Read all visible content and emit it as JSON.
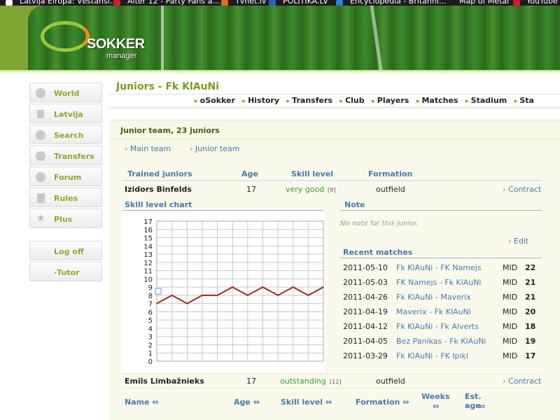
{
  "bookmarks": [
    {
      "label": "Latvija Eiropa: Vēstanši...",
      "icon_color": "#ffffff"
    },
    {
      "label": "Alter 12 - Party Fans a...",
      "icon_color": "#d02020"
    },
    {
      "label": "Tvnet.lv",
      "icon_color": "#e07020"
    },
    {
      "label": "POLITIKA.LV",
      "icon_color": "#3060c0"
    },
    {
      "label": "Encyclopedia - Britanni...",
      "icon_color": "#3080e0"
    },
    {
      "label": "Map of Metal",
      "icon_color": "#202020"
    },
    {
      "label": "YouTube",
      "icon_color": "#cc2020"
    }
  ],
  "logo": {
    "name": "SOKKER",
    "sub": "manager"
  },
  "sidebar": {
    "items": [
      {
        "label": "World",
        "icon": "globe-icon"
      },
      {
        "label": "Latvija",
        "icon": "flag-icon"
      },
      {
        "label": "Search",
        "icon": "magnifier-icon"
      },
      {
        "label": "Transfers",
        "icon": "transfer-arrows-icon"
      },
      {
        "label": "Forum",
        "icon": "people-icon"
      },
      {
        "label": "Rules",
        "icon": "document-icon"
      },
      {
        "label": "Plus",
        "icon": "star-icon"
      }
    ],
    "logoff": "Log off",
    "tutor": "·Tutor"
  },
  "page": {
    "title": "Juniors - Fk KlAuNi"
  },
  "mainnav": [
    "oSokker",
    "History",
    "Transfers",
    "Club",
    "Players",
    "Matches",
    "Stadium",
    "Sta"
  ],
  "panel": {
    "heading": "Junior team, 23 juniors",
    "tabs": [
      "Main team",
      "Junior team"
    ]
  },
  "trained_table": {
    "headers": {
      "name": "Trained juniors",
      "age": "Age",
      "skill": "Skill level",
      "formation": "Formation"
    },
    "rows": [
      {
        "name": "Izidors Binfelds",
        "age": "17",
        "skill": "very good",
        "skill_num": "[9]",
        "formation": "outfield",
        "action": "Contract"
      },
      {
        "name": "Emīls Limbažnieks",
        "age": "17",
        "skill": "outstanding",
        "skill_num": "[12]",
        "formation": "outfield",
        "action": "Contract"
      }
    ]
  },
  "chart_section": {
    "title": "Skill level chart"
  },
  "note_section": {
    "title": "Note",
    "empty_text": "No note for this junior.",
    "edit": "Edit"
  },
  "recent_matches": {
    "title": "Recent matches",
    "rows": [
      {
        "date": "2011-05-10",
        "match": "Fk KlAuNi - FK Namejs",
        "pos": "MID",
        "rating": "22"
      },
      {
        "date": "2011-05-03",
        "match": "FK Namejs - Fk KlAuNi",
        "pos": "MID",
        "rating": "21"
      },
      {
        "date": "2011-04-26",
        "match": "Fk KlAuNi - Maverix",
        "pos": "MID",
        "rating": "21"
      },
      {
        "date": "2011-04-19",
        "match": "Maverix - Fk KlAuNi",
        "pos": "MID",
        "rating": "20"
      },
      {
        "date": "2011-04-12",
        "match": "Fk KlAuNi - Fk Alverts",
        "pos": "MID",
        "rating": "18"
      },
      {
        "date": "2011-04-05",
        "match": "Bez Panikas - Fk KlAuNi",
        "pos": "MID",
        "rating": "19"
      },
      {
        "date": "2011-03-29",
        "match": "Fk KlAuNi - FK Ipiķi",
        "pos": "MID",
        "rating": "17"
      }
    ]
  },
  "juniors_table": {
    "headers": {
      "name": "Name",
      "age": "Age",
      "skill": "Skill level",
      "formation": "Formation",
      "weeks": "Weeks",
      "est_age": "Est. age"
    }
  },
  "chart_data": {
    "type": "line",
    "title": "Skill level chart",
    "y_ticks": [
      0,
      1,
      2,
      3,
      4,
      5,
      6,
      7,
      8,
      9,
      10,
      11,
      12,
      13,
      14,
      15,
      16,
      17
    ],
    "ylim": [
      0,
      17
    ],
    "x": [
      0,
      1,
      2,
      3,
      4,
      5,
      6,
      7,
      8,
      9,
      10,
      11
    ],
    "series": [
      {
        "values": [
          7,
          8,
          7,
          8,
          8,
          9,
          8,
          9,
          8,
          9,
          8,
          9
        ],
        "color": "#a02828"
      }
    ],
    "grid": true
  }
}
